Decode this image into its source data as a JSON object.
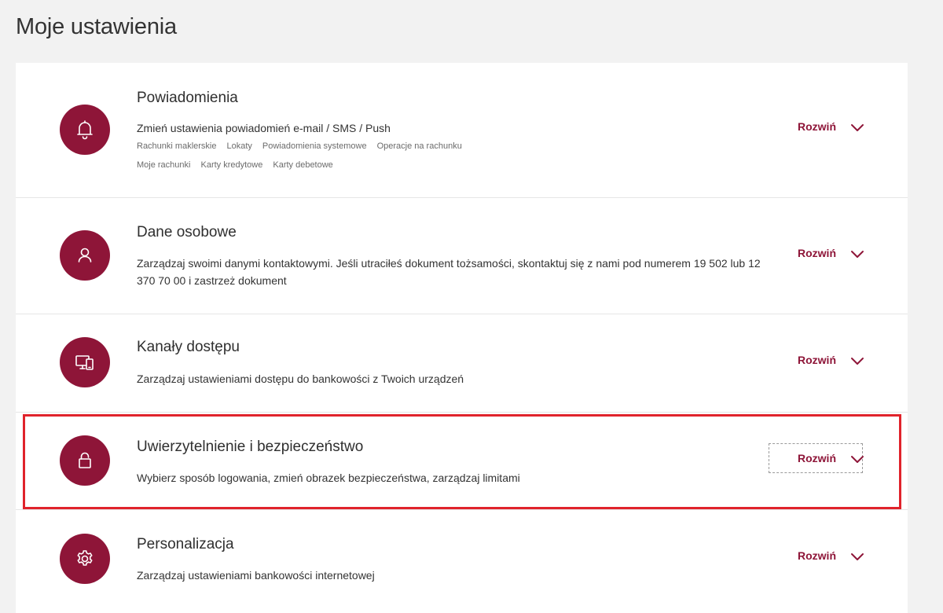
{
  "page": {
    "title": "Moje ustawienia"
  },
  "colors": {
    "accent": "#8e1538",
    "highlight": "#e0232b",
    "background": "#f2f2f2"
  },
  "sections": [
    {
      "title": "Powiadomienia",
      "description": "Zmień ustawienia powiadomień e-mail / SMS / Push",
      "icon": "bell-icon",
      "expand_label": "Rozwiń",
      "chips": [
        "Rachunki maklerskie",
        "Lokaty",
        "Powiadomienia systemowe",
        "Operacje na rachunku",
        "Moje rachunki",
        "Karty kredytowe",
        "Karty debetowe"
      ]
    },
    {
      "title": "Dane osobowe",
      "description": "Zarządzaj swoimi danymi kontaktowymi. Jeśli utraciłeś dokument tożsamości, skontaktuj się z nami pod numerem 19 502 lub 12 370 70 00 i zastrzeż dokument",
      "icon": "user-icon",
      "expand_label": "Rozwiń"
    },
    {
      "title": "Kanały dostępu",
      "description": "Zarządzaj ustawieniami dostępu do bankowości z Twoich urządzeń",
      "icon": "devices-icon",
      "expand_label": "Rozwiń"
    },
    {
      "title": "Uwierzytelnienie i bezpieczeństwo",
      "description": "Wybierz sposób logowania, zmień obrazek bezpieczeństwa, zarządzaj limitami",
      "icon": "lock-icon",
      "expand_label": "Rozwiń",
      "highlighted": true
    },
    {
      "title": "Personalizacja",
      "description": "Zarządzaj ustawieniami bankowości internetowej",
      "icon": "gear-icon",
      "expand_label": "Rozwiń"
    }
  ]
}
